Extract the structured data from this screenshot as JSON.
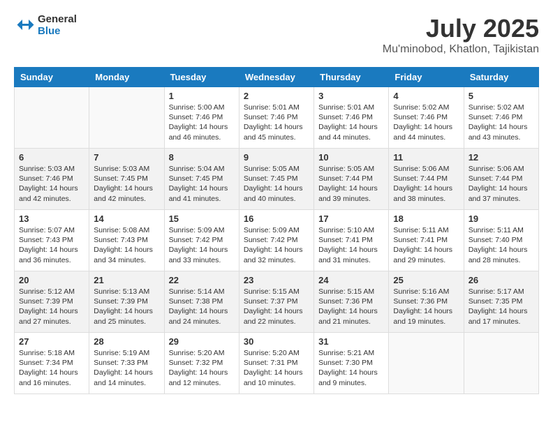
{
  "header": {
    "logo_line1": "General",
    "logo_line2": "Blue",
    "title": "July 2025",
    "subtitle": "Mu'minobod, Khatlon, Tajikistan"
  },
  "calendar": {
    "days_of_week": [
      "Sunday",
      "Monday",
      "Tuesday",
      "Wednesday",
      "Thursday",
      "Friday",
      "Saturday"
    ],
    "weeks": [
      [
        {
          "day": "",
          "content": ""
        },
        {
          "day": "",
          "content": ""
        },
        {
          "day": "1",
          "content": "Sunrise: 5:00 AM\nSunset: 7:46 PM\nDaylight: 14 hours\nand 46 minutes."
        },
        {
          "day": "2",
          "content": "Sunrise: 5:01 AM\nSunset: 7:46 PM\nDaylight: 14 hours\nand 45 minutes."
        },
        {
          "day": "3",
          "content": "Sunrise: 5:01 AM\nSunset: 7:46 PM\nDaylight: 14 hours\nand 44 minutes."
        },
        {
          "day": "4",
          "content": "Sunrise: 5:02 AM\nSunset: 7:46 PM\nDaylight: 14 hours\nand 44 minutes."
        },
        {
          "day": "5",
          "content": "Sunrise: 5:02 AM\nSunset: 7:46 PM\nDaylight: 14 hours\nand 43 minutes."
        }
      ],
      [
        {
          "day": "6",
          "content": "Sunrise: 5:03 AM\nSunset: 7:46 PM\nDaylight: 14 hours\nand 42 minutes."
        },
        {
          "day": "7",
          "content": "Sunrise: 5:03 AM\nSunset: 7:45 PM\nDaylight: 14 hours\nand 42 minutes."
        },
        {
          "day": "8",
          "content": "Sunrise: 5:04 AM\nSunset: 7:45 PM\nDaylight: 14 hours\nand 41 minutes."
        },
        {
          "day": "9",
          "content": "Sunrise: 5:05 AM\nSunset: 7:45 PM\nDaylight: 14 hours\nand 40 minutes."
        },
        {
          "day": "10",
          "content": "Sunrise: 5:05 AM\nSunset: 7:44 PM\nDaylight: 14 hours\nand 39 minutes."
        },
        {
          "day": "11",
          "content": "Sunrise: 5:06 AM\nSunset: 7:44 PM\nDaylight: 14 hours\nand 38 minutes."
        },
        {
          "day": "12",
          "content": "Sunrise: 5:06 AM\nSunset: 7:44 PM\nDaylight: 14 hours\nand 37 minutes."
        }
      ],
      [
        {
          "day": "13",
          "content": "Sunrise: 5:07 AM\nSunset: 7:43 PM\nDaylight: 14 hours\nand 36 minutes."
        },
        {
          "day": "14",
          "content": "Sunrise: 5:08 AM\nSunset: 7:43 PM\nDaylight: 14 hours\nand 34 minutes."
        },
        {
          "day": "15",
          "content": "Sunrise: 5:09 AM\nSunset: 7:42 PM\nDaylight: 14 hours\nand 33 minutes."
        },
        {
          "day": "16",
          "content": "Sunrise: 5:09 AM\nSunset: 7:42 PM\nDaylight: 14 hours\nand 32 minutes."
        },
        {
          "day": "17",
          "content": "Sunrise: 5:10 AM\nSunset: 7:41 PM\nDaylight: 14 hours\nand 31 minutes."
        },
        {
          "day": "18",
          "content": "Sunrise: 5:11 AM\nSunset: 7:41 PM\nDaylight: 14 hours\nand 29 minutes."
        },
        {
          "day": "19",
          "content": "Sunrise: 5:11 AM\nSunset: 7:40 PM\nDaylight: 14 hours\nand 28 minutes."
        }
      ],
      [
        {
          "day": "20",
          "content": "Sunrise: 5:12 AM\nSunset: 7:39 PM\nDaylight: 14 hours\nand 27 minutes."
        },
        {
          "day": "21",
          "content": "Sunrise: 5:13 AM\nSunset: 7:39 PM\nDaylight: 14 hours\nand 25 minutes."
        },
        {
          "day": "22",
          "content": "Sunrise: 5:14 AM\nSunset: 7:38 PM\nDaylight: 14 hours\nand 24 minutes."
        },
        {
          "day": "23",
          "content": "Sunrise: 5:15 AM\nSunset: 7:37 PM\nDaylight: 14 hours\nand 22 minutes."
        },
        {
          "day": "24",
          "content": "Sunrise: 5:15 AM\nSunset: 7:36 PM\nDaylight: 14 hours\nand 21 minutes."
        },
        {
          "day": "25",
          "content": "Sunrise: 5:16 AM\nSunset: 7:36 PM\nDaylight: 14 hours\nand 19 minutes."
        },
        {
          "day": "26",
          "content": "Sunrise: 5:17 AM\nSunset: 7:35 PM\nDaylight: 14 hours\nand 17 minutes."
        }
      ],
      [
        {
          "day": "27",
          "content": "Sunrise: 5:18 AM\nSunset: 7:34 PM\nDaylight: 14 hours\nand 16 minutes."
        },
        {
          "day": "28",
          "content": "Sunrise: 5:19 AM\nSunset: 7:33 PM\nDaylight: 14 hours\nand 14 minutes."
        },
        {
          "day": "29",
          "content": "Sunrise: 5:20 AM\nSunset: 7:32 PM\nDaylight: 14 hours\nand 12 minutes."
        },
        {
          "day": "30",
          "content": "Sunrise: 5:20 AM\nSunset: 7:31 PM\nDaylight: 14 hours\nand 10 minutes."
        },
        {
          "day": "31",
          "content": "Sunrise: 5:21 AM\nSunset: 7:30 PM\nDaylight: 14 hours\nand 9 minutes."
        },
        {
          "day": "",
          "content": ""
        },
        {
          "day": "",
          "content": ""
        }
      ]
    ]
  }
}
